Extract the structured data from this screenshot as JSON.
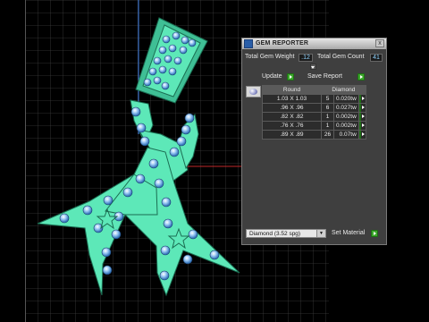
{
  "panel": {
    "title": "GEM REPORTER",
    "close_glyph": "x",
    "total_weight_label": "Total Gem Weight",
    "total_weight_value": ".12",
    "total_count_label": "Total Gem Count",
    "total_count_value": "41",
    "update_label": "Update",
    "save_report_label": "Save Report",
    "table": {
      "col_round": "Round",
      "col_diamond": "Diamond",
      "rows": [
        {
          "size": "1.03 X 1.03",
          "count": "5",
          "weight": "0.020tw"
        },
        {
          "size": ".96 X .96",
          "count": "6",
          "weight": "0.027tw"
        },
        {
          "size": ".82 X .82",
          "count": "1",
          "weight": "0.002tw"
        },
        {
          "size": ".76 X .76",
          "count": "1",
          "weight": "0.002tw"
        },
        {
          "size": ".89 X .89",
          "count": "26",
          "weight": "0.07tw"
        }
      ]
    },
    "material_select": "Diamond   (3.52 spg)",
    "set_material_label": "Set Material"
  },
  "icons": [
    "gem-reporter-icon",
    "close-icon",
    "arrow-right-icon",
    "round-gem-icon",
    "chevron-down-icon"
  ],
  "colors": {
    "viewport_bg": "#000000",
    "grid": "#4a4a4a",
    "model_fill": "#5de8b8",
    "gem": "#6fa7e8",
    "axis_red": "#c0282a",
    "axis_blue": "#3a7ae0",
    "panel_bg": "#3f3f3f",
    "accent_green": "#3ba82a"
  }
}
